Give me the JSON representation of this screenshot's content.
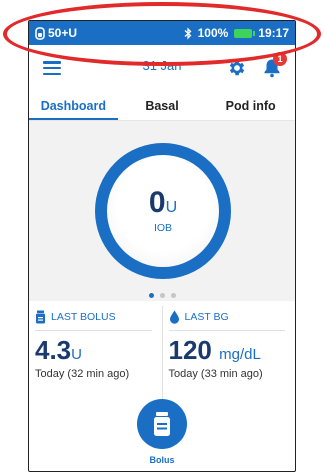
{
  "status_bar": {
    "pod_label": "50+U",
    "battery_percent": "100%",
    "time": "19:17",
    "icons": [
      "pod-icon",
      "bluetooth-icon",
      "battery-icon"
    ],
    "color": "#1a6fc4"
  },
  "header": {
    "date": "31 Jan",
    "notification_count": "1",
    "icons": [
      "menu-icon",
      "gear-icon",
      "bell-icon"
    ]
  },
  "tabs": [
    {
      "label": "Dashboard",
      "active": true
    },
    {
      "label": "Basal",
      "active": false
    },
    {
      "label": "Pod info",
      "active": false
    }
  ],
  "iob": {
    "value": "0",
    "unit": "U",
    "label": "IOB"
  },
  "page_indicator": {
    "count": 3,
    "active_index": 0
  },
  "last_bolus": {
    "title": "LAST BOLUS",
    "value": "4.3",
    "unit": "U",
    "time": "Today (32 min ago)",
    "icon": "bolus-vial-icon"
  },
  "last_bg": {
    "title": "LAST BG",
    "value": "120",
    "unit": "mg/dL",
    "time": "Today (33 min ago)",
    "icon": "blood-drop-icon"
  },
  "bolus_button": {
    "label": "Bolus",
    "icon": "bolus-vial-icon"
  },
  "colors": {
    "accent": "#1a6fc4",
    "dark_value": "#1a3a6f",
    "highlight": "#e22a2a",
    "badge": "#e53935"
  }
}
